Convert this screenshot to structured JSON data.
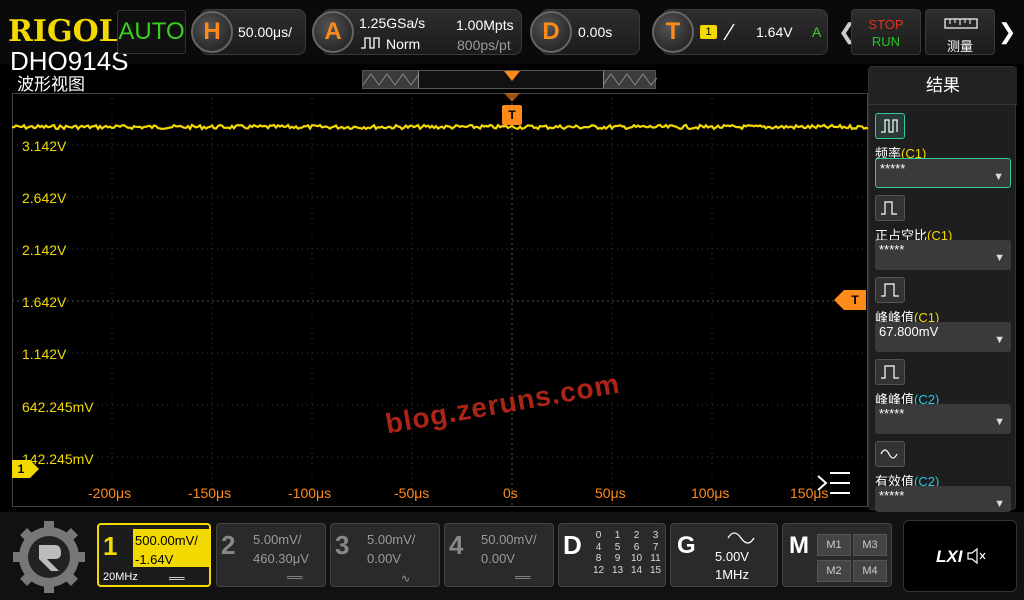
{
  "brand": {
    "logo": "RIGOL",
    "model": "DHO914S"
  },
  "top": {
    "trigger_mode": "AUTO",
    "horizontal": {
      "key": "H",
      "value": "50.00μs/"
    },
    "acquire": {
      "key": "A",
      "sample_rate": "1.25GSa/s",
      "mode": "Norm",
      "depth": "1.00Mpts",
      "resolution": "800ps/pt"
    },
    "delay": {
      "key": "D",
      "value": "0.00s"
    },
    "trigger": {
      "key": "T",
      "channel": "1",
      "level": "1.64V",
      "mode_letter": "A"
    },
    "stop_label": "STOP",
    "run_label": "RUN",
    "measure_label": "测量"
  },
  "view": {
    "title": "波形视图",
    "trigger_marker": "T",
    "channel_marker": "1",
    "watermark": "blog.zeruns.com",
    "y_labels": [
      "3.142V",
      "2.642V",
      "2.142V",
      "1.642V",
      "1.142V",
      "642.245mV",
      "142.245mV"
    ],
    "x_labels": [
      "-200μs",
      "-150μs",
      "-100μs",
      "-50μs",
      "0s",
      "50μs",
      "100μs",
      "150μs"
    ]
  },
  "results": {
    "title": "结果",
    "items": [
      {
        "name": "频率",
        "ch": "(C1)",
        "value": "*****"
      },
      {
        "name": "正占空比",
        "ch": "(C1)",
        "value": "*****"
      },
      {
        "name": "峰峰值",
        "ch": "(C1)",
        "value": "67.800mV"
      },
      {
        "name": "峰峰值",
        "ch": "(C2)",
        "value": "*****"
      },
      {
        "name": "有效值",
        "ch": "(C2)",
        "value": "*****"
      }
    ]
  },
  "channels": [
    {
      "num": "1",
      "scale": "500.00mV/",
      "offset": "-1.64V",
      "bw": "20MHz"
    },
    {
      "num": "2",
      "scale": "5.00mV/",
      "offset": "460.30μV"
    },
    {
      "num": "3",
      "scale": "5.00mV/",
      "offset": "0.00V"
    },
    {
      "num": "4",
      "scale": "50.00mV/",
      "offset": "0.00V"
    }
  ],
  "digital": {
    "key": "D",
    "bits": [
      [
        "0",
        "1",
        "2",
        "3"
      ],
      [
        "4",
        "5",
        "6",
        "7"
      ],
      [
        "8",
        "9",
        "10",
        "11"
      ],
      [
        "12",
        "13",
        "14",
        "15"
      ]
    ]
  },
  "generator": {
    "key": "G",
    "amplitude": "5.00V",
    "frequency": "1MHz"
  },
  "math": {
    "key": "M",
    "buttons": [
      "M1",
      "M3",
      "M2",
      "M4"
    ]
  },
  "lxi": "LXI",
  "colors": {
    "ch1": "#f2d900",
    "ch2": "#27c8e6",
    "trigger": "#ff8a1c",
    "accent": "#34c8a4"
  }
}
